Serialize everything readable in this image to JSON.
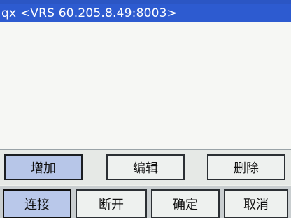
{
  "list": {
    "selected_item": "qx <VRS  60.205.8.49:8003>"
  },
  "actions": {
    "add_label": "增加",
    "edit_label": "编辑",
    "delete_label": "删除"
  },
  "bottom": {
    "connect_label": "连接",
    "disconnect_label": "断开",
    "confirm_label": "确定",
    "cancel_label": "取消"
  }
}
